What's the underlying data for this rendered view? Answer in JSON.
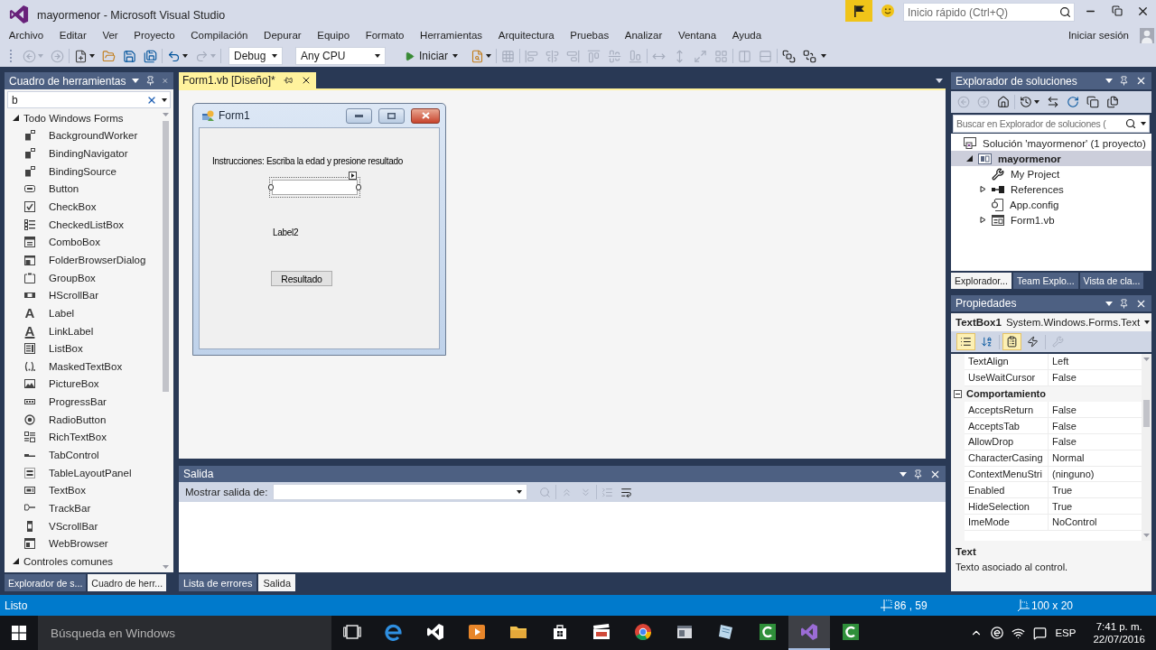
{
  "window": {
    "title": "mayormenor - Microsoft Visual Studio",
    "quick_launch": {
      "placeholder": "Inicio rápido (Ctrl+Q)"
    },
    "sign_in": "Iniciar sesión"
  },
  "menu": [
    "Archivo",
    "Editar",
    "Ver",
    "Proyecto",
    "Compilación",
    "Depurar",
    "Equipo",
    "Formato",
    "Herramientas",
    "Arquitectura",
    "Pruebas",
    "Analizar",
    "Ventana",
    "Ayuda"
  ],
  "toolbar": {
    "left_groups": [
      [
        {
          "kind": "back",
          "disabled": true,
          "dropdown": true
        },
        {
          "kind": "forward",
          "disabled": true
        }
      ],
      [
        {
          "kind": "new-project",
          "disabled": false,
          "dropdown": true
        },
        {
          "kind": "open",
          "disabled": false
        },
        {
          "kind": "save",
          "disabled": false
        },
        {
          "kind": "save-all",
          "disabled": false
        }
      ],
      [
        {
          "kind": "undo",
          "disabled": false,
          "dropdown": true
        },
        {
          "kind": "redo",
          "disabled": true,
          "dropdown": true
        }
      ]
    ],
    "configuration": "Debug",
    "platform": "Any CPU",
    "start": "Iniciar",
    "right_groups": [
      [
        {
          "kind": "find",
          "disabled": false,
          "dropdown": true
        }
      ],
      [
        {
          "kind": "snap",
          "disabled": true
        }
      ],
      [
        {
          "kind": "align-left",
          "disabled": true
        },
        {
          "kind": "align-center",
          "disabled": true
        },
        {
          "kind": "align-right",
          "disabled": true
        },
        {
          "kind": "align-top",
          "disabled": true
        },
        {
          "kind": "align-middle",
          "disabled": true
        },
        {
          "kind": "align-bottom",
          "disabled": true
        }
      ],
      [
        {
          "kind": "same-width",
          "disabled": true
        },
        {
          "kind": "same-height",
          "disabled": true
        },
        {
          "kind": "same-size",
          "disabled": true
        },
        {
          "kind": "size-to-grid",
          "disabled": true
        }
      ],
      [
        {
          "kind": "h-spacing",
          "disabled": true
        },
        {
          "kind": "v-spacing",
          "disabled": true
        }
      ],
      [
        {
          "kind": "bring-front",
          "disabled": false
        },
        {
          "kind": "send-back",
          "disabled": false
        }
      ]
    ]
  },
  "toolbox": {
    "title": "Cuadro de herramientas",
    "search": {
      "value": "b"
    },
    "groups": [
      {
        "label": "Todo Windows Forms",
        "expanded": true,
        "items": [
          {
            "kind": "component",
            "label": "BackgroundWorker"
          },
          {
            "kind": "component",
            "label": "BindingNavigator"
          },
          {
            "kind": "component",
            "label": "BindingSource"
          },
          {
            "kind": "button",
            "label": "Button"
          },
          {
            "kind": "checkbox",
            "label": "CheckBox"
          },
          {
            "kind": "checked-list",
            "label": "CheckedListBox"
          },
          {
            "kind": "combo",
            "label": "ComboBox"
          },
          {
            "kind": "dialog",
            "label": "FolderBrowserDialog"
          },
          {
            "kind": "group",
            "label": "GroupBox"
          },
          {
            "kind": "hscroll",
            "label": "HScrollBar"
          },
          {
            "kind": "label",
            "glyph": "A",
            "label": "Label"
          },
          {
            "kind": "link-label",
            "glyph": "A",
            "label": "LinkLabel"
          },
          {
            "kind": "listbox",
            "label": "ListBox"
          },
          {
            "kind": "masked",
            "label": "MaskedTextBox"
          },
          {
            "kind": "picture",
            "label": "PictureBox"
          },
          {
            "kind": "progress",
            "label": "ProgressBar"
          },
          {
            "kind": "radio",
            "label": "RadioButton"
          },
          {
            "kind": "rich-text",
            "label": "RichTextBox"
          },
          {
            "kind": "tab",
            "label": "TabControl"
          },
          {
            "kind": "table-layout",
            "label": "TableLayoutPanel"
          },
          {
            "kind": "textbox",
            "label": "TextBox"
          },
          {
            "kind": "trackbar",
            "label": "TrackBar"
          },
          {
            "kind": "vscroll",
            "label": "VScrollBar"
          },
          {
            "kind": "browser",
            "label": "WebBrowser"
          }
        ]
      },
      {
        "label": "Controles comunes",
        "expanded": true
      }
    ],
    "tabs": [
      {
        "label": "Explorador de s...",
        "selected": false
      },
      {
        "label": "Cuadro de herr...",
        "selected": true
      }
    ]
  },
  "document_tabs": [
    {
      "label": "Form1.vb [Diseño]*",
      "selected": true
    }
  ],
  "designer": {
    "form": {
      "title": "Form1",
      "controls": [
        {
          "kind": "label",
          "text": "Instrucciones: Escriba la edad y presione resultado",
          "selected": false
        },
        {
          "kind": "textbox",
          "selected": true
        },
        {
          "kind": "label",
          "text": "Label2",
          "selected": false
        },
        {
          "kind": "button",
          "text": "Resultado",
          "selected": false
        }
      ]
    }
  },
  "output": {
    "title": "Salida",
    "source_label": "Mostrar salida de:",
    "button_groups": [
      [
        {
          "kind": "find-message",
          "disabled": true
        }
      ],
      [
        {
          "kind": "go-prev",
          "disabled": true
        },
        {
          "kind": "go-next",
          "disabled": true
        }
      ],
      [
        {
          "kind": "clear",
          "disabled": true
        },
        {
          "kind": "word-wrap",
          "disabled": false
        }
      ]
    ],
    "tabs": [
      {
        "label": "Lista de errores",
        "selected": false
      },
      {
        "label": "Salida",
        "selected": true
      }
    ]
  },
  "solution_explorer": {
    "title": "Explorador de soluciones",
    "button_groups": [
      [
        {
          "kind": "back",
          "disabled": true
        },
        {
          "kind": "forward",
          "disabled": true
        },
        {
          "kind": "home",
          "disabled": false
        }
      ],
      [
        {
          "kind": "history",
          "disabled": false,
          "dropdown": true
        },
        {
          "kind": "sync",
          "disabled": false
        },
        {
          "kind": "refresh",
          "disabled": false
        },
        {
          "kind": "collapse-all",
          "disabled": false
        },
        {
          "kind": "show-all",
          "disabled": false
        }
      ]
    ],
    "search": {
      "placeholder": "Buscar en Explorador de soluciones ("
    },
    "tree": [
      {
        "kind": "solution",
        "label": "Solución 'mayormenor' (1 proyecto)",
        "expanded": true,
        "selected": false,
        "children": [
          {
            "kind": "project",
            "label": "mayormenor",
            "expanded": true,
            "selected": true,
            "children": [
              {
                "kind": "properties",
                "label": "My Project",
                "selected": false
              },
              {
                "kind": "references",
                "label": "References",
                "expanded": false,
                "selected": false
              },
              {
                "kind": "config",
                "label": "App.config",
                "selected": false
              },
              {
                "kind": "form",
                "label": "Form1.vb",
                "expanded": false,
                "selected": false
              }
            ]
          }
        ]
      }
    ],
    "tabs": [
      {
        "label": "Explorador...",
        "selected": true
      },
      {
        "label": "Team Explo...",
        "selected": false
      },
      {
        "label": "Vista de cla...",
        "selected": false
      }
    ]
  },
  "properties": {
    "title": "Propiedades",
    "object": "TextBox1",
    "type": "System.Windows.Forms.Text",
    "button_groups": [
      [
        {
          "kind": "categorized",
          "selected": true,
          "disabled": false
        },
        {
          "kind": "alphabetical",
          "selected": false,
          "disabled": false
        }
      ],
      [
        {
          "kind": "properties",
          "selected": true,
          "disabled": false
        },
        {
          "kind": "events",
          "selected": false,
          "disabled": false
        }
      ],
      [
        {
          "kind": "property-pages",
          "selected": false,
          "disabled": true
        }
      ]
    ],
    "rows": [
      {
        "kind": "property",
        "name": "TextAlign",
        "value": "Left"
      },
      {
        "kind": "property",
        "name": "UseWaitCursor",
        "value": "False"
      },
      {
        "kind": "category",
        "name": "Comportamiento",
        "expanded": true
      },
      {
        "kind": "property",
        "name": "AcceptsReturn",
        "value": "False"
      },
      {
        "kind": "property",
        "name": "AcceptsTab",
        "value": "False"
      },
      {
        "kind": "property",
        "name": "AllowDrop",
        "value": "False"
      },
      {
        "kind": "property",
        "name": "CharacterCasing",
        "value": "Normal"
      },
      {
        "kind": "property",
        "name": "ContextMenuStri",
        "value": "(ninguno)"
      },
      {
        "kind": "property",
        "name": "Enabled",
        "value": "True"
      },
      {
        "kind": "property",
        "name": "HideSelection",
        "value": "True"
      },
      {
        "kind": "property",
        "name": "ImeMode",
        "value": "NoControl"
      }
    ],
    "description": {
      "title": "Text",
      "text": "Texto asociado al control."
    }
  },
  "status_bar": {
    "text": "Listo",
    "position": "86 , 59",
    "size": "100 x 20"
  },
  "taskbar": {
    "search": {
      "placeholder": "Búsqueda en Windows"
    },
    "apps": [
      {
        "kind": "task-view",
        "active": false
      },
      {
        "kind": "edge",
        "active": false
      },
      {
        "kind": "vs-code",
        "active": false
      },
      {
        "kind": "media-player",
        "active": false
      },
      {
        "kind": "file-explorer",
        "active": false
      },
      {
        "kind": "store",
        "active": false
      },
      {
        "kind": "video-editor",
        "active": false
      },
      {
        "kind": "chrome",
        "active": false
      },
      {
        "kind": "app",
        "active": false
      },
      {
        "kind": "notes",
        "active": false
      },
      {
        "kind": "camtasia",
        "active": false
      },
      {
        "kind": "visual-studio",
        "active": true
      },
      {
        "kind": "camtasia",
        "active": false
      }
    ],
    "language": "ESP",
    "time": "7:41 p. m.",
    "date": "22/07/2016"
  }
}
